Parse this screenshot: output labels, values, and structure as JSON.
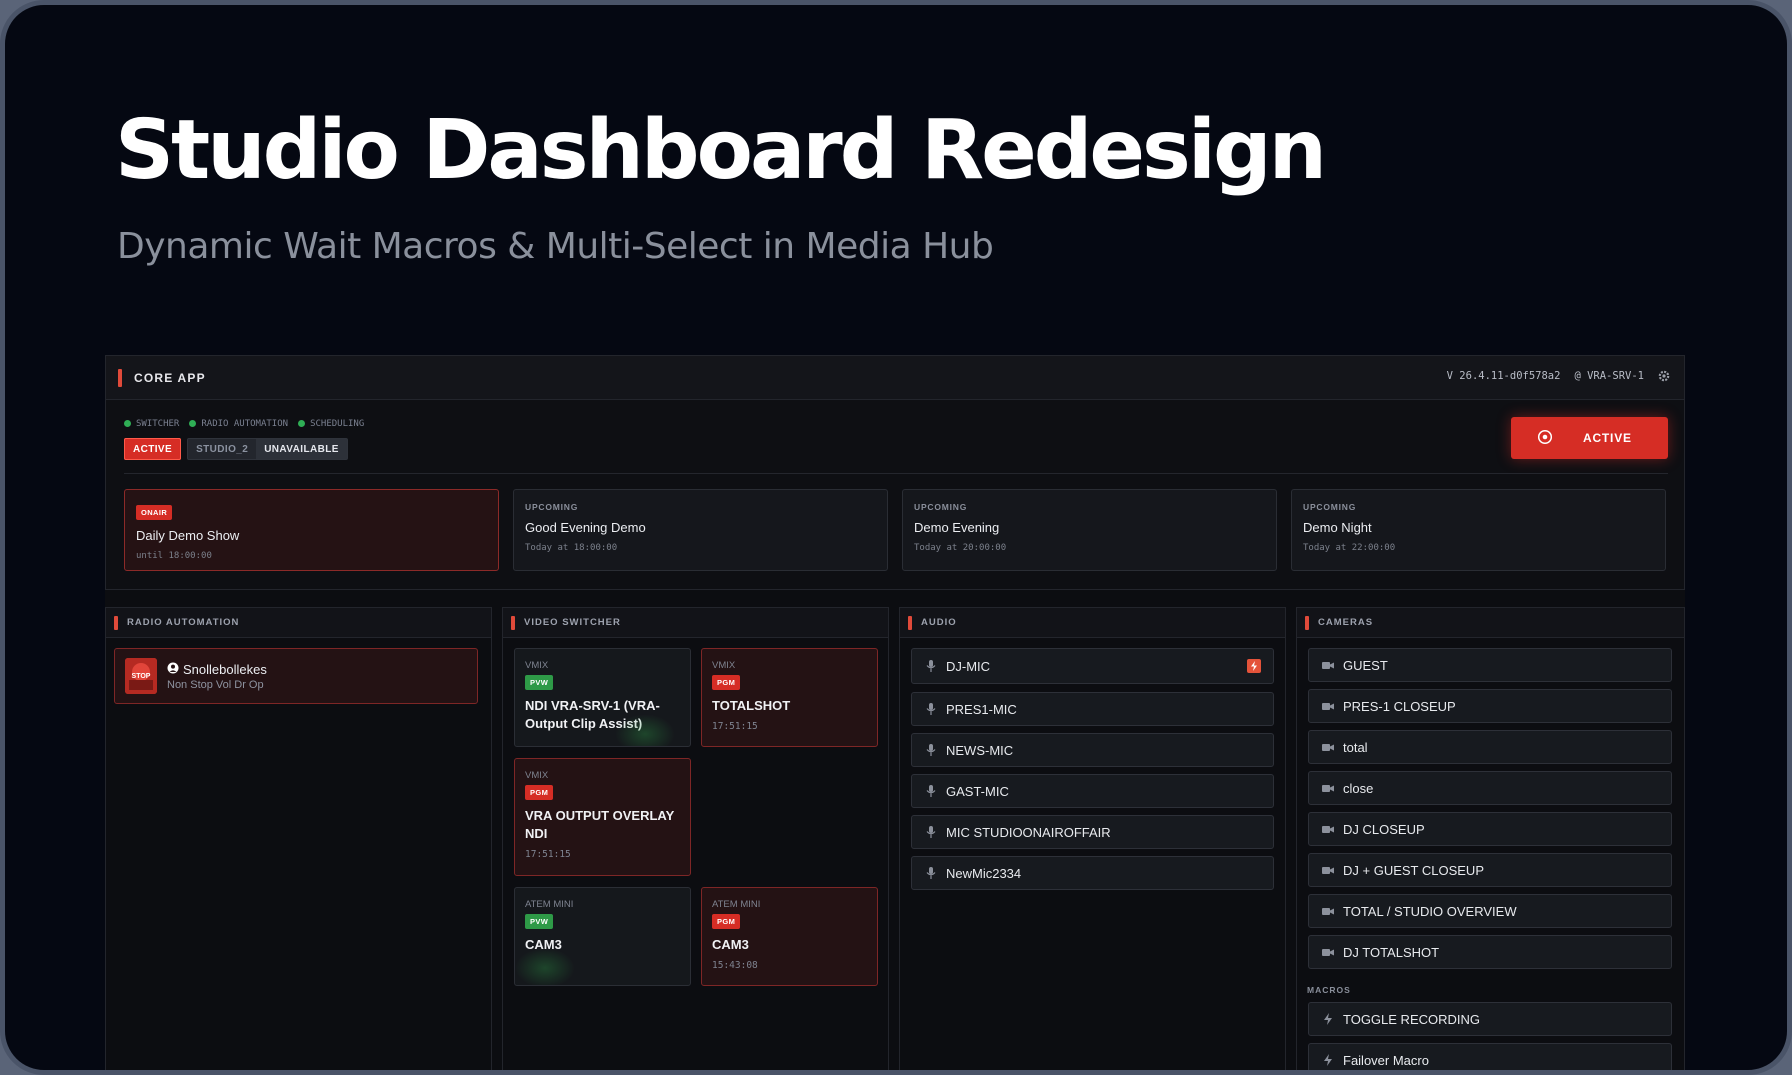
{
  "hero": {
    "title": "Studio Dashboard Redesign",
    "subtitle": "Dynamic Wait Macros & Multi-Select in Media Hub"
  },
  "topbar": {
    "title": "CORE APP",
    "version": "V 26.4.11-d0f578a2",
    "server": "@ VRA-SRV-1"
  },
  "services": [
    "SWITCHER",
    "RADIO AUTOMATION",
    "SCHEDULING"
  ],
  "studios": {
    "active": "ACTIVE",
    "studio2": "STUDIO_2",
    "unavailable": "UNAVAILABLE"
  },
  "active_button": "ACTIVE",
  "shows": [
    {
      "badge": "ONAIR",
      "name": "Daily Demo Show",
      "time": "until 18:00:00"
    },
    {
      "badge": "UPCOMING",
      "name": "Good Evening Demo",
      "time": "Today at 18:00:00"
    },
    {
      "badge": "UPCOMING",
      "name": "Demo Evening",
      "time": "Today at 20:00:00"
    },
    {
      "badge": "UPCOMING",
      "name": "Demo Night",
      "time": "Today at 22:00:00"
    }
  ],
  "radio": {
    "header": "RADIO AUTOMATION",
    "logo_text": "STOP",
    "item": {
      "name": "Snollebollekes",
      "sub": "Non Stop Vol Dr Op"
    }
  },
  "video": {
    "header": "VIDEO SWITCHER",
    "items": [
      {
        "source": "VMIX",
        "badge": "PVW",
        "name": "NDI VRA-SRV-1 (VRA-Output Clip Assist)",
        "time": ""
      },
      {
        "source": "VMIX",
        "badge": "PGM",
        "name": "TOTALSHOT",
        "time": "17:51:15"
      },
      {
        "source": "VMIX",
        "badge": "PGM",
        "name": "VRA OUTPUT OVERLAY NDI",
        "time": "17:51:15"
      },
      {
        "source": "ATEM MINI",
        "badge": "PVW",
        "name": "CAM3",
        "time": ""
      },
      {
        "source": "ATEM MINI",
        "badge": "PGM",
        "name": "CAM3",
        "time": "15:43:08"
      }
    ]
  },
  "audio": {
    "header": "AUDIO",
    "items": [
      "DJ-MIC",
      "PRES1-MIC",
      "NEWS-MIC",
      "GAST-MIC",
      "MIC STUDIOONAIROFFAIR",
      "NewMic2334"
    ]
  },
  "cameras": {
    "header": "CAMERAS",
    "items": [
      "GUEST",
      "PRES-1 CLOSEUP",
      "total",
      "close",
      "DJ CLOSEUP",
      "DJ + GUEST CLOSEUP",
      "TOTAL / STUDIO OVERVIEW",
      "DJ TOTALSHOT"
    ],
    "macros_label": "MACROS",
    "macros": [
      "TOGGLE RECORDING",
      "Failover Macro"
    ]
  },
  "colors": {
    "accent": "#e04a3a",
    "active_red": "#d62d25",
    "pvw_green": "#2e9a47",
    "bg": "#050812"
  }
}
